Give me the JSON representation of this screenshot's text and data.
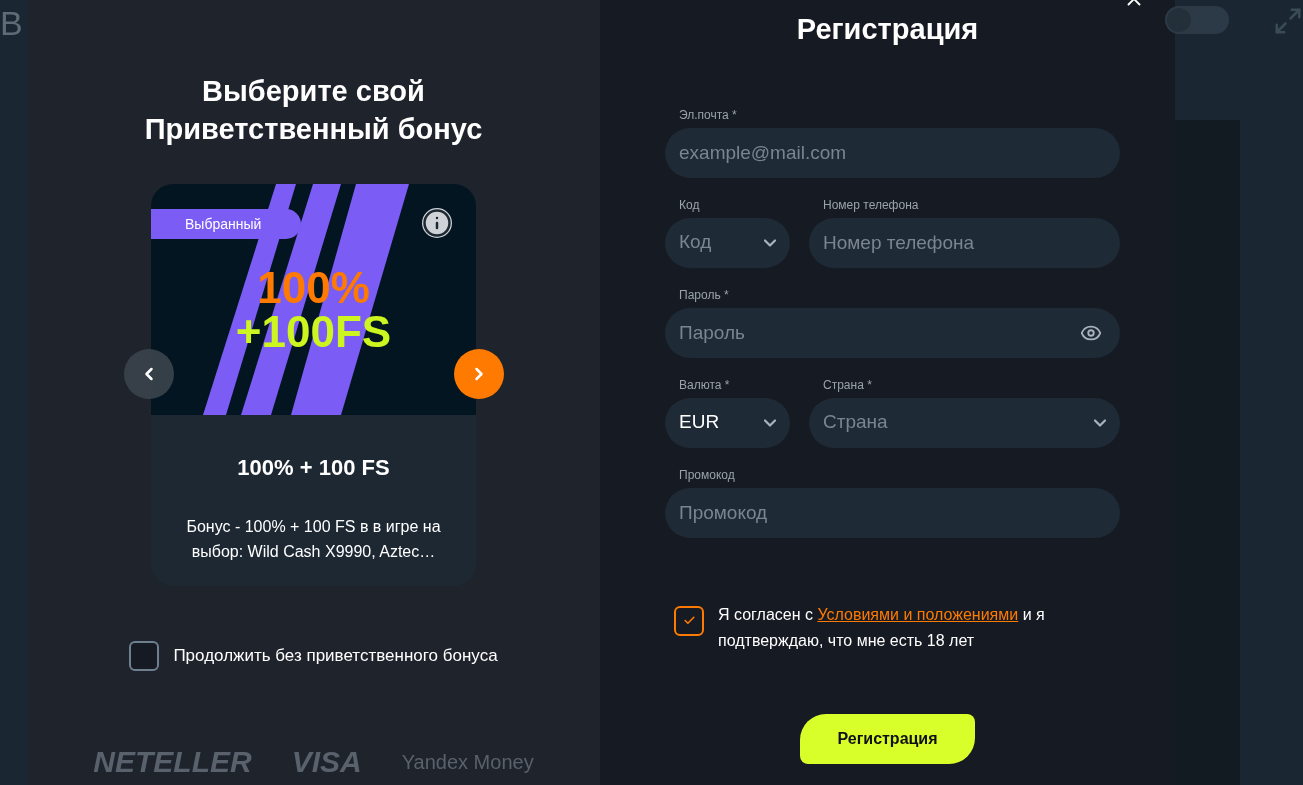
{
  "background_page": {
    "title_fragment": "В",
    "toggle": {
      "on": false
    }
  },
  "bonus_panel": {
    "title_lines": [
      "Выберите свой",
      "Приветственный бонус"
    ],
    "card": {
      "badge": "Выбранный",
      "banner_lines": [
        "100%",
        "+100FS"
      ],
      "title": "100% + 100 FS",
      "description": "Бонус - 100% + 100 FS в в игре на выбор: Wild Cash X9990, Aztec…",
      "selected": true
    },
    "skip_bonus": {
      "label": "Продолжить без приветственного бонуса",
      "checked": false
    },
    "payment_logos": [
      "NETELLER",
      "VISA",
      "Yandex Money"
    ]
  },
  "registration": {
    "title": "Регистрация",
    "fields": [
      {
        "kind": "text",
        "label": "Эл.почта *",
        "placeholder": "example@mail.com"
      },
      {
        "kind": "row",
        "items": [
          {
            "kind": "select",
            "label": "Код",
            "placeholder": "Код"
          },
          {
            "kind": "text",
            "label": "Номер телефона",
            "placeholder": "Номер телефона"
          }
        ]
      },
      {
        "kind": "password",
        "label": "Пароль *",
        "placeholder": "Пароль"
      },
      {
        "kind": "row",
        "items": [
          {
            "kind": "select",
            "label": "Валюта *",
            "value": "EUR"
          },
          {
            "kind": "select",
            "label": "Страна *",
            "placeholder": "Страна"
          }
        ]
      },
      {
        "kind": "text",
        "label": "Промокод",
        "placeholder": "Промокод"
      }
    ],
    "consent": {
      "checked": true,
      "before": "Я согласен с ",
      "link": "Условиями и положениями",
      "after": " и я подтверждаю, что мне есть 18 лет"
    },
    "submit": "Регистрация"
  }
}
